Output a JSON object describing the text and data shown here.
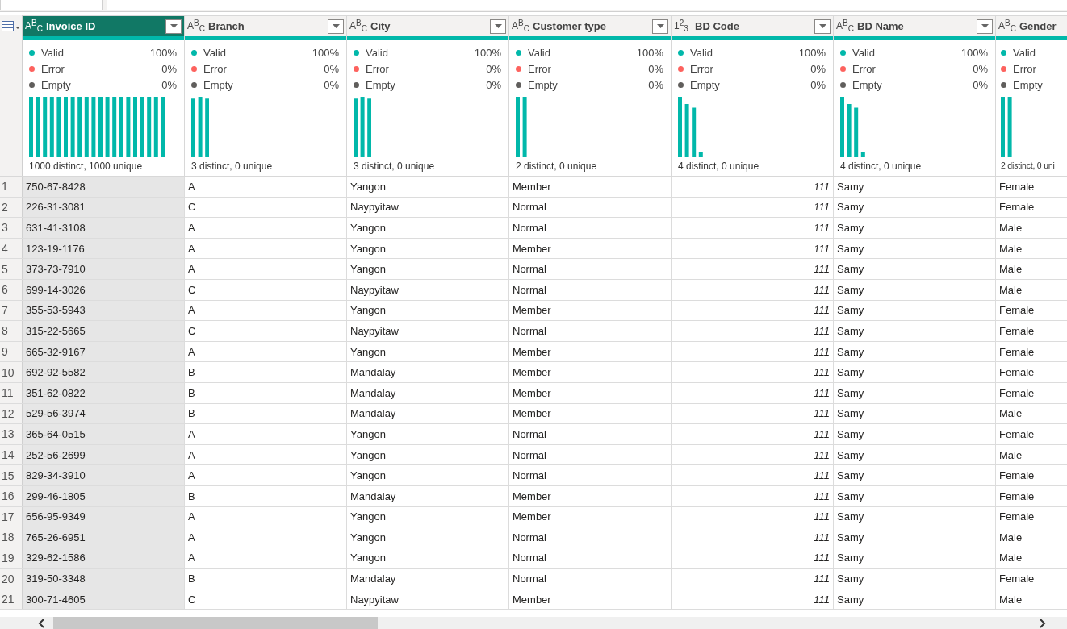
{
  "columns": [
    {
      "name": "Invoice ID",
      "kind": "text",
      "type_icon": "A$^{B}$$_{C}$",
      "selected": true,
      "histogram": {
        "kind": "many"
      },
      "footer": "1000 distinct, 1000 unique",
      "stats": [
        {
          "label": "Valid",
          "pct": "100%",
          "color": "#01b8aa"
        },
        {
          "label": "Error",
          "pct": "0%",
          "color": "#fd625e"
        },
        {
          "label": "Empty",
          "pct": "0%",
          "color": "#605e5c"
        }
      ]
    },
    {
      "name": "Branch",
      "kind": "text",
      "type_icon": "A$^{B}$$_{C}$",
      "selected": false,
      "histogram": {
        "kind": "three"
      },
      "footer": "3 distinct, 0 unique",
      "stats": [
        {
          "label": "Valid",
          "pct": "100%",
          "color": "#01b8aa"
        },
        {
          "label": "Error",
          "pct": "0%",
          "color": "#fd625e"
        },
        {
          "label": "Empty",
          "pct": "0%",
          "color": "#605e5c"
        }
      ]
    },
    {
      "name": "City",
      "kind": "text",
      "type_icon": "A$^{B}$$_{C}$",
      "selected": false,
      "histogram": {
        "kind": "three"
      },
      "footer": "3 distinct, 0 unique",
      "stats": [
        {
          "label": "Valid",
          "pct": "100%",
          "color": "#01b8aa"
        },
        {
          "label": "Error",
          "pct": "0%",
          "color": "#fd625e"
        },
        {
          "label": "Empty",
          "pct": "0%",
          "color": "#605e5c"
        }
      ]
    },
    {
      "name": "Customer type",
      "kind": "text",
      "type_icon": "A$^{B}$$_{C}$",
      "selected": false,
      "histogram": {
        "kind": "two"
      },
      "footer": "2 distinct, 0 unique",
      "stats": [
        {
          "label": "Valid",
          "pct": "100%",
          "color": "#01b8aa"
        },
        {
          "label": "Error",
          "pct": "0%",
          "color": "#fd625e"
        },
        {
          "label": "Empty",
          "pct": "0%",
          "color": "#605e5c"
        }
      ]
    },
    {
      "name": "BD Code",
      "kind": "number",
      "type_icon": "1$^{2}$$_{3}$",
      "selected": false,
      "histogram": {
        "kind": "four-falling"
      },
      "footer": "4 distinct, 0 unique",
      "stats": [
        {
          "label": "Valid",
          "pct": "100%",
          "color": "#01b8aa"
        },
        {
          "label": "Error",
          "pct": "0%",
          "color": "#fd625e"
        },
        {
          "label": "Empty",
          "pct": "0%",
          "color": "#605e5c"
        }
      ]
    },
    {
      "name": "BD Name",
      "kind": "text",
      "type_icon": "A$^{B}$$_{C}$",
      "selected": false,
      "histogram": {
        "kind": "four-falling"
      },
      "footer": "4 distinct, 0 unique",
      "stats": [
        {
          "label": "Valid",
          "pct": "100%",
          "color": "#01b8aa"
        },
        {
          "label": "Error",
          "pct": "0%",
          "color": "#fd625e"
        },
        {
          "label": "Empty",
          "pct": "0%",
          "color": "#605e5c"
        }
      ]
    },
    {
      "name": "Gender",
      "kind": "text",
      "type_icon": "A$^{B}$$_{C}$",
      "selected": false,
      "histogram": {
        "kind": "two"
      },
      "footer": "2 distinct, 0 uni",
      "stats": [
        {
          "label": "Valid",
          "color": "#01b8aa"
        },
        {
          "label": "Error",
          "color": "#fd625e"
        },
        {
          "label": "Empty",
          "color": "#605e5c"
        }
      ]
    }
  ],
  "rows": [
    {
      "n": "1",
      "cells": [
        "750-67-8428",
        "A",
        "Yangon",
        "Member",
        "111",
        "Samy",
        "Female"
      ]
    },
    {
      "n": "2",
      "cells": [
        "226-31-3081",
        "C",
        "Naypyitaw",
        "Normal",
        "111",
        "Samy",
        "Female"
      ]
    },
    {
      "n": "3",
      "cells": [
        "631-41-3108",
        "A",
        "Yangon",
        "Normal",
        "111",
        "Samy",
        "Male"
      ]
    },
    {
      "n": "4",
      "cells": [
        "123-19-1176",
        "A",
        "Yangon",
        "Member",
        "111",
        "Samy",
        "Male"
      ]
    },
    {
      "n": "5",
      "cells": [
        "373-73-7910",
        "A",
        "Yangon",
        "Normal",
        "111",
        "Samy",
        "Male"
      ]
    },
    {
      "n": "6",
      "cells": [
        "699-14-3026",
        "C",
        "Naypyitaw",
        "Normal",
        "111",
        "Samy",
        "Male"
      ]
    },
    {
      "n": "7",
      "cells": [
        "355-53-5943",
        "A",
        "Yangon",
        "Member",
        "111",
        "Samy",
        "Female"
      ]
    },
    {
      "n": "8",
      "cells": [
        "315-22-5665",
        "C",
        "Naypyitaw",
        "Normal",
        "111",
        "Samy",
        "Female"
      ]
    },
    {
      "n": "9",
      "cells": [
        "665-32-9167",
        "A",
        "Yangon",
        "Member",
        "111",
        "Samy",
        "Female"
      ]
    },
    {
      "n": "10",
      "cells": [
        "692-92-5582",
        "B",
        "Mandalay",
        "Member",
        "111",
        "Samy",
        "Female"
      ]
    },
    {
      "n": "11",
      "cells": [
        "351-62-0822",
        "B",
        "Mandalay",
        "Member",
        "111",
        "Samy",
        "Female"
      ]
    },
    {
      "n": "12",
      "cells": [
        "529-56-3974",
        "B",
        "Mandalay",
        "Member",
        "111",
        "Samy",
        "Male"
      ]
    },
    {
      "n": "13",
      "cells": [
        "365-64-0515",
        "A",
        "Yangon",
        "Normal",
        "111",
        "Samy",
        "Female"
      ]
    },
    {
      "n": "14",
      "cells": [
        "252-56-2699",
        "A",
        "Yangon",
        "Normal",
        "111",
        "Samy",
        "Male"
      ]
    },
    {
      "n": "15",
      "cells": [
        "829-34-3910",
        "A",
        "Yangon",
        "Normal",
        "111",
        "Samy",
        "Female"
      ]
    },
    {
      "n": "16",
      "cells": [
        "299-46-1805",
        "B",
        "Mandalay",
        "Member",
        "111",
        "Samy",
        "Female"
      ]
    },
    {
      "n": "17",
      "cells": [
        "656-95-9349",
        "A",
        "Yangon",
        "Member",
        "111",
        "Samy",
        "Female"
      ]
    },
    {
      "n": "18",
      "cells": [
        "765-26-6951",
        "A",
        "Yangon",
        "Normal",
        "111",
        "Samy",
        "Male"
      ]
    },
    {
      "n": "19",
      "cells": [
        "329-62-1586",
        "A",
        "Yangon",
        "Normal",
        "111",
        "Samy",
        "Male"
      ]
    },
    {
      "n": "20",
      "cells": [
        "319-50-3348",
        "B",
        "Mandalay",
        "Normal",
        "111",
        "Samy",
        "Female"
      ]
    },
    {
      "n": "21",
      "cells": [
        "300-71-4605",
        "C",
        "Naypyitaw",
        "Member",
        "111",
        "Samy",
        "Male"
      ]
    }
  ]
}
